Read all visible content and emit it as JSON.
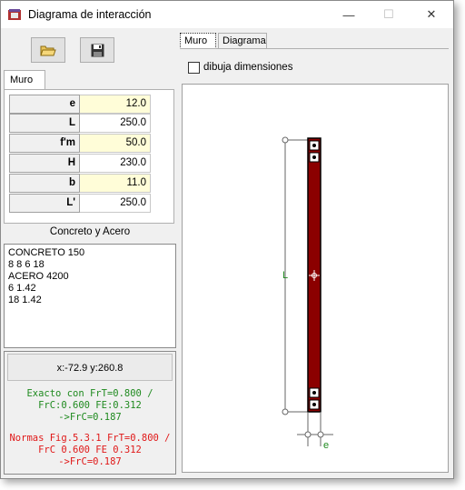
{
  "window": {
    "title": "Diagrama de interacción",
    "min_glyph": "—",
    "max_glyph": "☐",
    "close_glyph": "✕"
  },
  "toolbar": {
    "open_icon": "folder-open-icon",
    "save_icon": "floppy-save-icon"
  },
  "left_tab": "Muro",
  "properties": [
    {
      "label": "e",
      "value": "12.0",
      "highlight": true
    },
    {
      "label": "L",
      "value": "250.0",
      "highlight": false
    },
    {
      "label": "f'm",
      "value": "50.0",
      "highlight": true
    },
    {
      "label": "H",
      "value": "230.0",
      "highlight": false
    },
    {
      "label": "b",
      "value": "11.0",
      "highlight": true
    },
    {
      "label": "L'",
      "value": "250.0",
      "highlight": false
    }
  ],
  "materials_title": "Concreto y Acero",
  "materials_lines": [
    "CONCRETO 150",
    "8 8 6 18",
    "ACERO 4200",
    "6 1.42",
    "18 1.42"
  ],
  "coords": "x:-72.9 y:260.8",
  "green_lines": [
    "Exacto con FrT=0.800 /",
    "FrC:0.600 FE:0.312",
    "->FrC=0.187"
  ],
  "red_lines": [
    "Normas Fig.5.3.1 FrT=0.800 /",
    "FrC 0.600 FE 0.312",
    "->FrC=0.187"
  ],
  "right_tabs": [
    "Muro",
    "Diagrama"
  ],
  "checkbox_label": "dibuja dimensiones",
  "drawing": {
    "length_label": "L",
    "width_label": "e",
    "wall_color": "#8b0000",
    "dim_color_L": "#1f8a1f",
    "dim_color_e": "#1f8a1f"
  }
}
